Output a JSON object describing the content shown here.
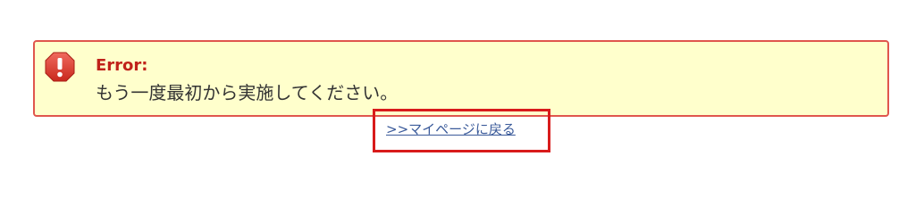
{
  "alert": {
    "title": "Error:",
    "message": "もう一度最初から実施してください。",
    "icon": "error-icon",
    "colors": {
      "background": "#ffffcc",
      "border": "#e0564d",
      "title": "#c0221a",
      "icon": "#d9362b"
    }
  },
  "navigation": {
    "back_link_label": ">>マイページに戻る",
    "highlight_color": "#d81b1b"
  }
}
